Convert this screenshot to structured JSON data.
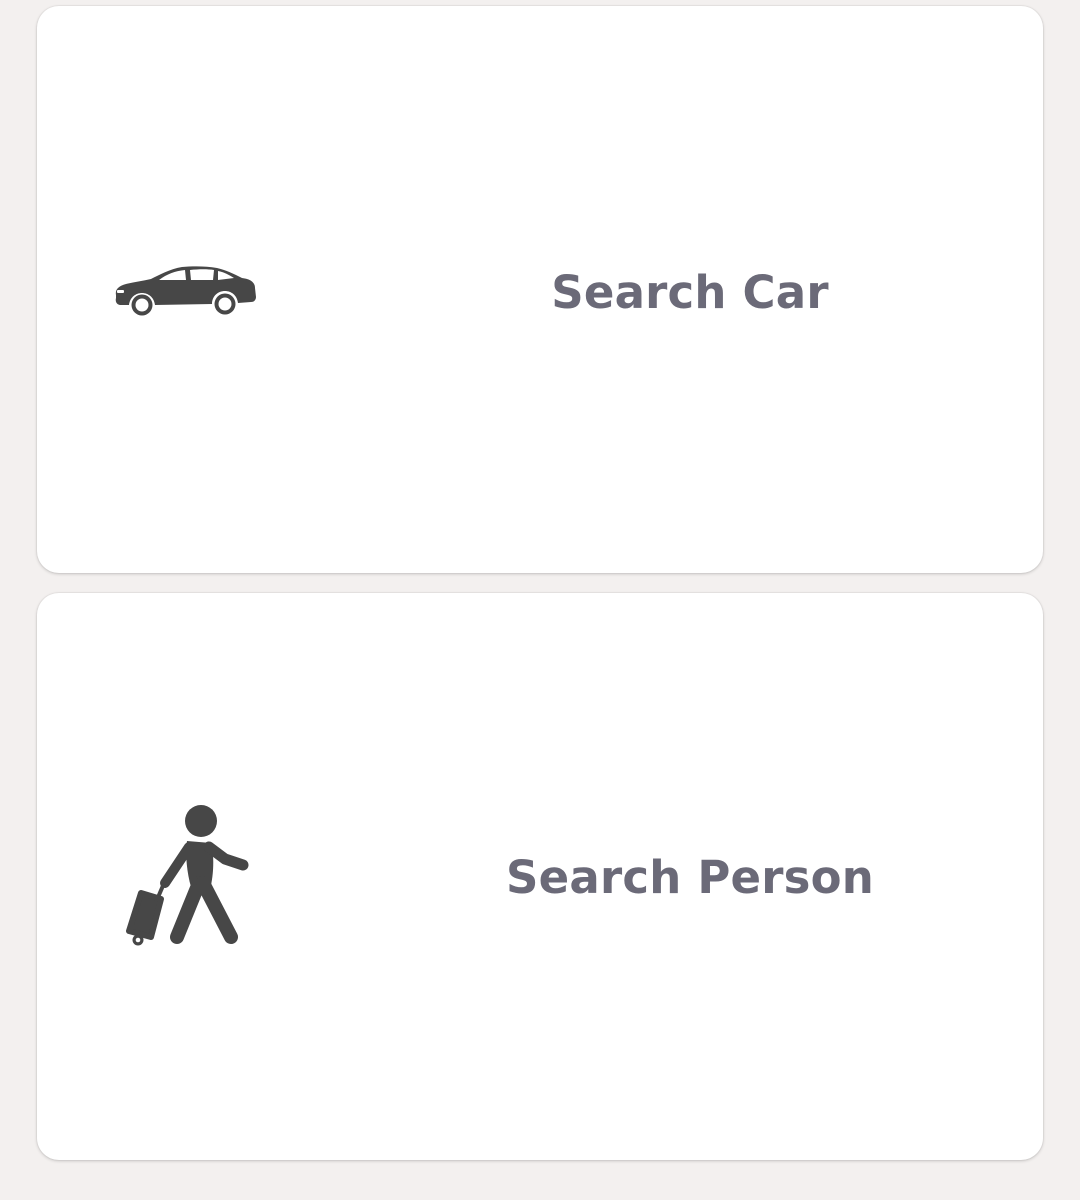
{
  "colors": {
    "background": "#f3f0ef",
    "card": "#ffffff",
    "label_text": "#6b6a78",
    "icon": "#474747"
  },
  "options": [
    {
      "label": "Search Car",
      "icon": "car-icon"
    },
    {
      "label": "Search Person",
      "icon": "traveler-with-luggage-icon"
    }
  ]
}
